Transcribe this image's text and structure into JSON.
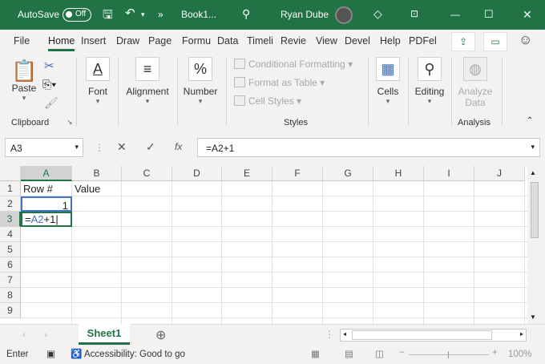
{
  "title_bar": {
    "autosave_label": "AutoSave",
    "autosave_state": "Off",
    "doc_name": "Book1...",
    "user_name": "Ryan Dube"
  },
  "tabs": [
    "File",
    "Home",
    "Insert",
    "Draw",
    "Page",
    "Formu",
    "Data",
    "Timeli",
    "Revie",
    "View",
    "Devel",
    "Help",
    "PDFel"
  ],
  "ribbon": {
    "clipboard": {
      "paste": "Paste",
      "label": "Clipboard"
    },
    "font": "Font",
    "alignment": "Alignment",
    "number": "Number",
    "styles": {
      "conditional": "Conditional Formatting",
      "format_table": "Format as Table",
      "cell_styles": "Cell Styles",
      "label": "Styles"
    },
    "cells": "Cells",
    "editing": "Editing",
    "analysis": {
      "analyze": "Analyze",
      "data": "Data",
      "label": "Analysis"
    }
  },
  "formula_bar": {
    "name_box": "A3",
    "formula": "=A2+1"
  },
  "columns": [
    "A",
    "B",
    "C",
    "D",
    "E",
    "F",
    "G",
    "H",
    "I",
    "J"
  ],
  "rows": [
    "1",
    "2",
    "3",
    "4",
    "5",
    "6",
    "7",
    "8",
    "9"
  ],
  "cells": {
    "A1": "Row #",
    "B1": "Value",
    "A2": "1",
    "A3_eq": "=",
    "A3_ref": "A2",
    "A3_rest": "+1"
  },
  "sheet": {
    "name": "Sheet1"
  },
  "status": {
    "mode": "Enter",
    "accessibility": "Accessibility: Good to go",
    "zoom": "100%"
  },
  "colors": {
    "brand": "#217346",
    "ref": "#4472c4"
  }
}
